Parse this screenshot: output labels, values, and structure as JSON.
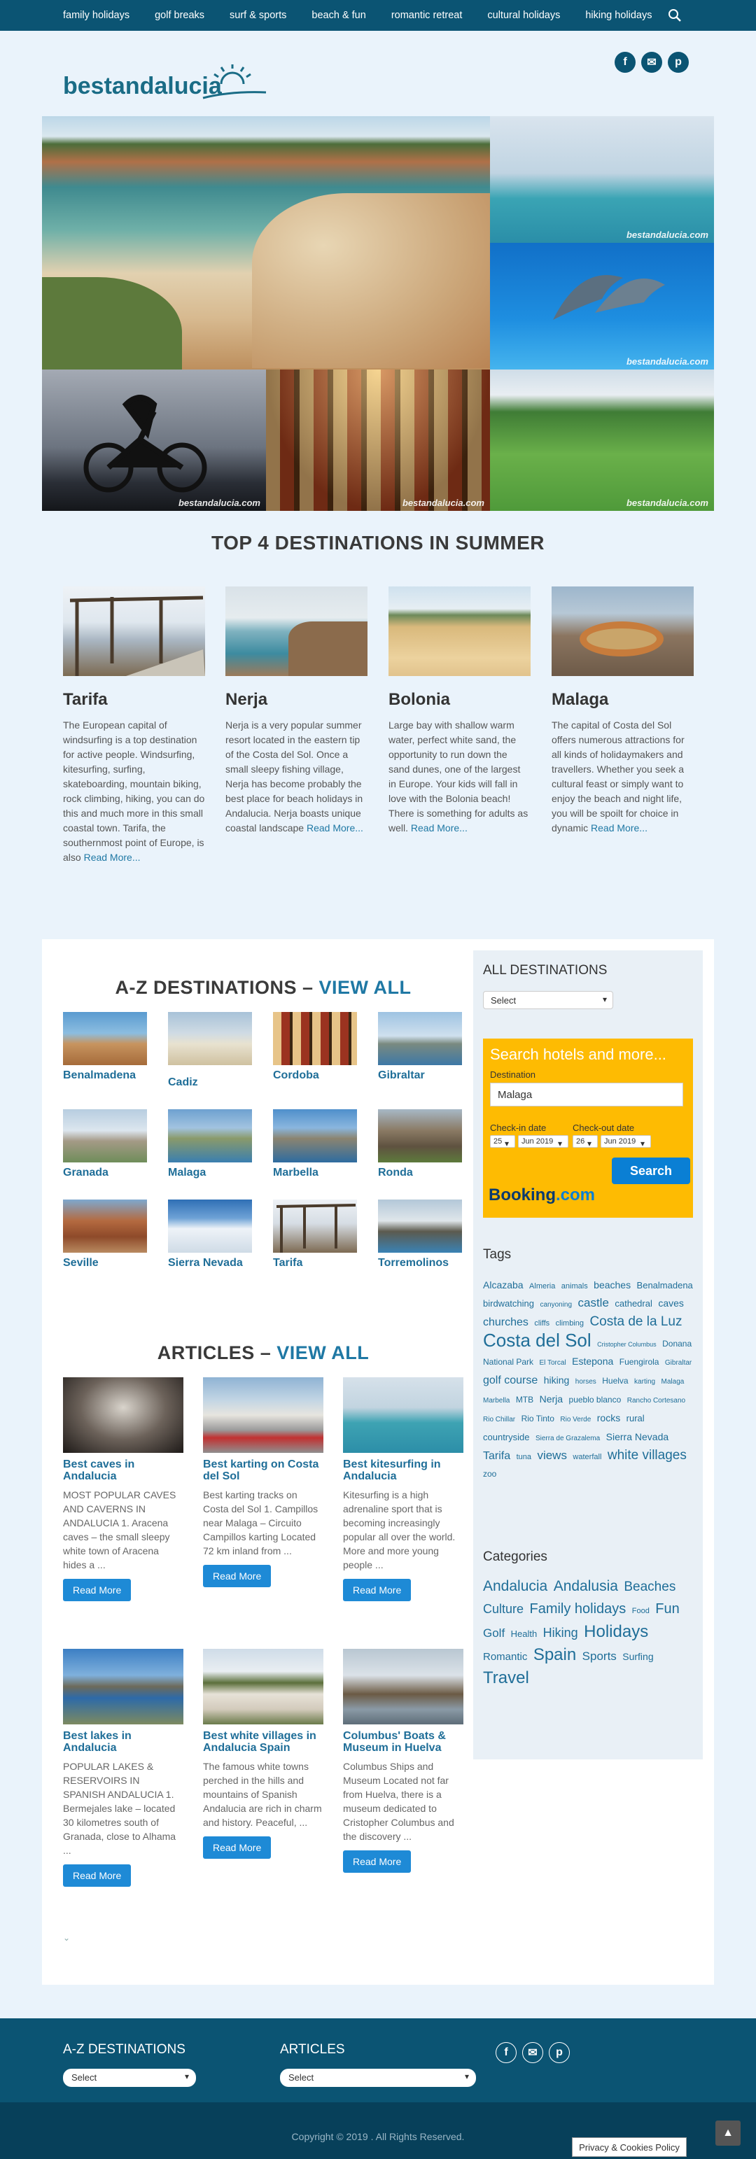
{
  "nav": {
    "items": [
      "family holidays",
      "golf breaks",
      "surf & sports",
      "beach & fun",
      "romantic retreat",
      "cultural holidays",
      "hiking holidays"
    ]
  },
  "logo": {
    "text": "bestandalucia"
  },
  "social": {
    "facebook": "f",
    "email": "✉",
    "pinterest": "p"
  },
  "hero": {
    "watermark": "bestandalucia.com"
  },
  "top4": {
    "title": "TOP 4 DESTINATIONS IN SUMMER",
    "items": [
      {
        "name": "Tarifa",
        "text": "The European capital of windsurfing is a top destination for active people. Windsurfing, kitesurfing, surfing, skateboarding, mountain biking, rock climbing, hiking, you can do this and much more in this small coastal town. Tarifa, the southernmost point of Europe, is also ",
        "more": "Read More..."
      },
      {
        "name": "Nerja",
        "text": "Nerja is a very popular summer resort located in the eastern tip of the Costa del Sol. Once a small sleepy fishing village, Nerja has become probably the best place for beach holidays in Andalucia. Nerja boasts unique coastal landscape ",
        "more": "Read More..."
      },
      {
        "name": "Bolonia",
        "text": "Large bay with shallow warm water, perfect white sand, the opportunity to run down the sand dunes, one of the largest in Europe. Your kids will fall in love with the Bolonia beach! There is something for adults as well. ",
        "more": "Read More..."
      },
      {
        "name": "Malaga",
        "text": "The capital of Costa del Sol offers numerous attractions for all kinds of holidaymakers and travellers. Whether you seek a cultural feast or simply want to enjoy the beach and night life, you will be spoilt for choice in dynamic ",
        "more": "Read More..."
      }
    ]
  },
  "az": {
    "title": "A-Z DESTINATIONS –",
    "view_all": "VIEW ALL",
    "items": [
      "Benalmadena",
      "Cadiz",
      "Cordoba",
      "Gibraltar",
      "Granada",
      "Malaga",
      "Marbella",
      "Ronda",
      "Seville",
      "Sierra Nevada",
      "Tarifa",
      "Torremolinos"
    ]
  },
  "articles": {
    "title": "ARTICLES –",
    "view_all": "VIEW ALL",
    "button": "Read More",
    "items": [
      {
        "title": "Best caves in Andalucia",
        "text": "MOST POPULAR CAVES AND CAVERNS IN ANDALUCIA 1. Aracena caves – the small sleepy white town of Aracena hides a ..."
      },
      {
        "title": "Best karting on Costa del Sol",
        "text": "Best karting tracks on Costa del Sol 1. Campillos near Malaga – Circuito Campillos karting Located 72 km inland from ..."
      },
      {
        "title": "Best kitesurfing in Andalucia",
        "text": "Kitesurfing is a high adrenaline sport that is becoming increasingly popular all over the world. More and more young people ..."
      },
      {
        "title": "Best lakes in Andalucia",
        "text": "POPULAR LAKES & RESERVOIRS IN SPANISH ANDALUCIA 1. Bermejales lake – located 30 kilometres south of Granada, close to Alhama ..."
      },
      {
        "title": "Best white villages in Andalucia Spain",
        "text": "The famous white towns perched in the hills and mountains of Spanish Andalucia are rich in charm and history. Peaceful, ..."
      },
      {
        "title": "Columbus' Boats & Museum in Huelva",
        "text": "Columbus Ships and Museum Located not far from Huelva, there is a museum dedicated to Cristopher Columbus and the discovery ..."
      }
    ]
  },
  "sidebar": {
    "all_title": "ALL DESTINATIONS",
    "select": "Select",
    "booking": {
      "title": "Search hotels and more...",
      "dest_label": "Destination",
      "dest_value": "Malaga",
      "checkin_label": "Check-in date",
      "checkout_label": "Check-out date",
      "checkin_day": "25",
      "checkin_month": "Jun 2019",
      "checkout_day": "26",
      "checkout_month": "Jun 2019",
      "search": "Search",
      "logo1": "Booking",
      "logo2": ".com"
    },
    "tags_title": "Tags",
    "tags": [
      {
        "t": "Alcazaba",
        "s": 14
      },
      {
        "t": "Almeria",
        "s": 11
      },
      {
        "t": "animals",
        "s": 11
      },
      {
        "t": "beaches",
        "s": 14
      },
      {
        "t": "Benalmadena",
        "s": 13
      },
      {
        "t": "birdwatching",
        "s": 13
      },
      {
        "t": "canyoning",
        "s": 10
      },
      {
        "t": "castle",
        "s": 17
      },
      {
        "t": "cathedral",
        "s": 13
      },
      {
        "t": "caves",
        "s": 14
      },
      {
        "t": "churches",
        "s": 16
      },
      {
        "t": "cliffs",
        "s": 11
      },
      {
        "t": "climbing",
        "s": 11
      },
      {
        "t": "Costa de la Luz",
        "s": 19
      },
      {
        "t": "Costa del Sol",
        "s": 26
      },
      {
        "t": "Cristopher Columbus",
        "s": 9
      },
      {
        "t": "Donana National Park",
        "s": 12
      },
      {
        "t": "El Torcal",
        "s": 10
      },
      {
        "t": "Estepona",
        "s": 14
      },
      {
        "t": "Fuengirola",
        "s": 12
      },
      {
        "t": "Gibraltar",
        "s": 10
      },
      {
        "t": "golf course",
        "s": 16
      },
      {
        "t": "hiking",
        "s": 14
      },
      {
        "t": "horses",
        "s": 10
      },
      {
        "t": "Huelva",
        "s": 12
      },
      {
        "t": "karting",
        "s": 10
      },
      {
        "t": "Malaga",
        "s": 10
      },
      {
        "t": "Marbella",
        "s": 10
      },
      {
        "t": "MTB",
        "s": 12
      },
      {
        "t": "Nerja",
        "s": 14
      },
      {
        "t": "pueblo blanco",
        "s": 12
      },
      {
        "t": "Rancho Cortesano",
        "s": 10
      },
      {
        "t": "Rio Chillar",
        "s": 10
      },
      {
        "t": "Rio Tinto",
        "s": 12
      },
      {
        "t": "Rio Verde",
        "s": 10
      },
      {
        "t": "rocks",
        "s": 14
      },
      {
        "t": "rural countryside",
        "s": 13
      },
      {
        "t": "Sierra de Grazalema",
        "s": 10
      },
      {
        "t": "Sierra Nevada",
        "s": 14
      },
      {
        "t": "Tarifa",
        "s": 16
      },
      {
        "t": "tuna",
        "s": 11
      },
      {
        "t": "views",
        "s": 17
      },
      {
        "t": "waterfall",
        "s": 11
      },
      {
        "t": "white villages",
        "s": 19
      },
      {
        "t": "zoo",
        "s": 12
      }
    ],
    "cats_title": "Categories",
    "cats": [
      {
        "t": "Andalucia",
        "s": 21
      },
      {
        "t": "Andalusia",
        "s": 21
      },
      {
        "t": "Beaches",
        "s": 19
      },
      {
        "t": "Culture",
        "s": 18
      },
      {
        "t": "Family holidays",
        "s": 20
      },
      {
        "t": "Food",
        "s": 11
      },
      {
        "t": "Fun",
        "s": 20
      },
      {
        "t": "Golf",
        "s": 17
      },
      {
        "t": "Health",
        "s": 13
      },
      {
        "t": "Hiking",
        "s": 18
      },
      {
        "t": "Holidays",
        "s": 24
      },
      {
        "t": "Romantic",
        "s": 15
      },
      {
        "t": "Spain",
        "s": 24
      },
      {
        "t": "Sports",
        "s": 17
      },
      {
        "t": "Surfing",
        "s": 14
      },
      {
        "t": "Travel",
        "s": 24
      }
    ]
  },
  "footer": {
    "az_title": "A-Z DESTINATIONS",
    "articles_title": "ARTICLES",
    "select": "Select",
    "copyright": "Copyright © 2019 . All Rights Reserved.",
    "privacy": "Privacy & Cookies Policy"
  },
  "colors": {
    "nav": "#0b5473",
    "accent": "#1f78a4",
    "booking": "#febb02",
    "button": "#1e8ad6"
  }
}
